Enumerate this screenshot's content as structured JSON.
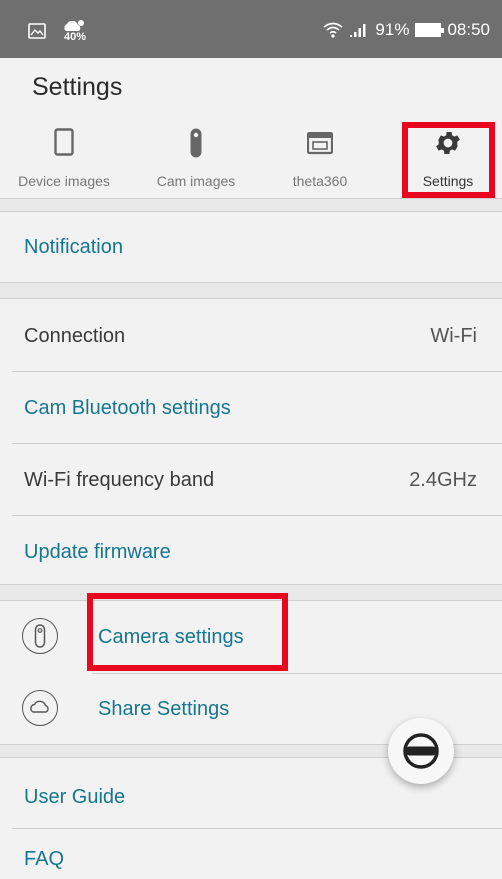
{
  "status_bar": {
    "weather": "40%",
    "battery": "91%",
    "time": "08:50"
  },
  "header": {
    "title": "Settings",
    "tabs": [
      {
        "label": "Device images",
        "icon": "phone-icon"
      },
      {
        "label": "Cam images",
        "icon": "camera-icon"
      },
      {
        "label": "theta360",
        "icon": "theta360-icon"
      },
      {
        "label": "Settings",
        "icon": "gear-icon",
        "active": true
      }
    ]
  },
  "settings": {
    "notification": "Notification",
    "connection": {
      "label": "Connection",
      "value": "Wi-Fi"
    },
    "cam_bluetooth": "Cam Bluetooth settings",
    "wifi_band": {
      "label": "Wi-Fi frequency band",
      "value": "2.4GHz"
    },
    "update_firmware": "Update firmware",
    "camera_settings": "Camera settings",
    "share_settings": "Share Settings",
    "user_guide": "User Guide",
    "faq": "FAQ"
  },
  "colors": {
    "accent": "#167690",
    "highlight": "#e8071f",
    "status_bar": "#6f6f6f"
  }
}
